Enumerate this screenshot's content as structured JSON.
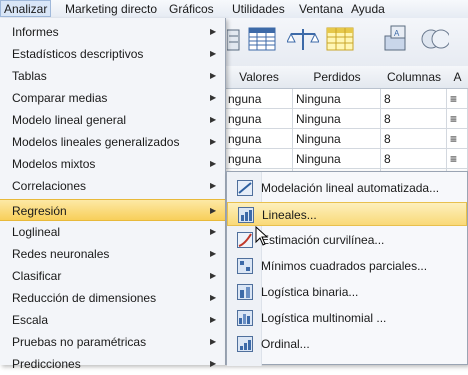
{
  "menubar": {
    "items": [
      {
        "label": "Analizar"
      },
      {
        "label": "Marketing directo"
      },
      {
        "label": "Gráficos"
      },
      {
        "label": "Utilidades"
      },
      {
        "label": "Ventana"
      },
      {
        "label": "Ayuda"
      }
    ]
  },
  "analizar_menu": {
    "items": [
      {
        "label": "Informes"
      },
      {
        "label": "Estadísticos descriptivos"
      },
      {
        "label": "Tablas"
      },
      {
        "label": "Comparar medias"
      },
      {
        "label": "Modelo lineal general"
      },
      {
        "label": "Modelos lineales generalizados"
      },
      {
        "label": "Modelos mixtos"
      },
      {
        "label": "Correlaciones"
      },
      {
        "label": "Regresión"
      },
      {
        "label": "Loglineal"
      },
      {
        "label": "Redes neuronales"
      },
      {
        "label": "Clasificar"
      },
      {
        "label": "Reducción de dimensiones"
      },
      {
        "label": "Escala"
      },
      {
        "label": "Pruebas no paramétricas"
      },
      {
        "label": "Predicciones"
      }
    ]
  },
  "regresion_submenu": {
    "items": [
      {
        "label": "Modelación lineal automatizada...",
        "icon": "auto-linear-model-icon"
      },
      {
        "label": "Lineales...",
        "icon": "linear-regression-icon"
      },
      {
        "label": "Estimación curvilínea...",
        "icon": "curve-estimation-icon"
      },
      {
        "label": "Mínimos cuadrados parciales...",
        "icon": "partial-least-squares-icon"
      },
      {
        "label": "Logística binaria...",
        "icon": "binary-logistic-icon"
      },
      {
        "label": "Logística multinomial ...",
        "icon": "multinomial-logistic-icon"
      },
      {
        "label": "Ordinal...",
        "icon": "ordinal-icon"
      }
    ]
  },
  "grid": {
    "headers": [
      "Valores",
      "Perdidos",
      "Columnas",
      "A"
    ],
    "rows": [
      [
        "nguna",
        "Ninguna",
        "8"
      ],
      [
        "nguna",
        "Ninguna",
        "8"
      ],
      [
        "nguna",
        "Ninguna",
        "8"
      ],
      [
        "nguna",
        "Ninguna",
        "8"
      ]
    ]
  },
  "colors": {
    "highlight": "#f8cf5a",
    "menu_bg": "#f3f5f9"
  }
}
